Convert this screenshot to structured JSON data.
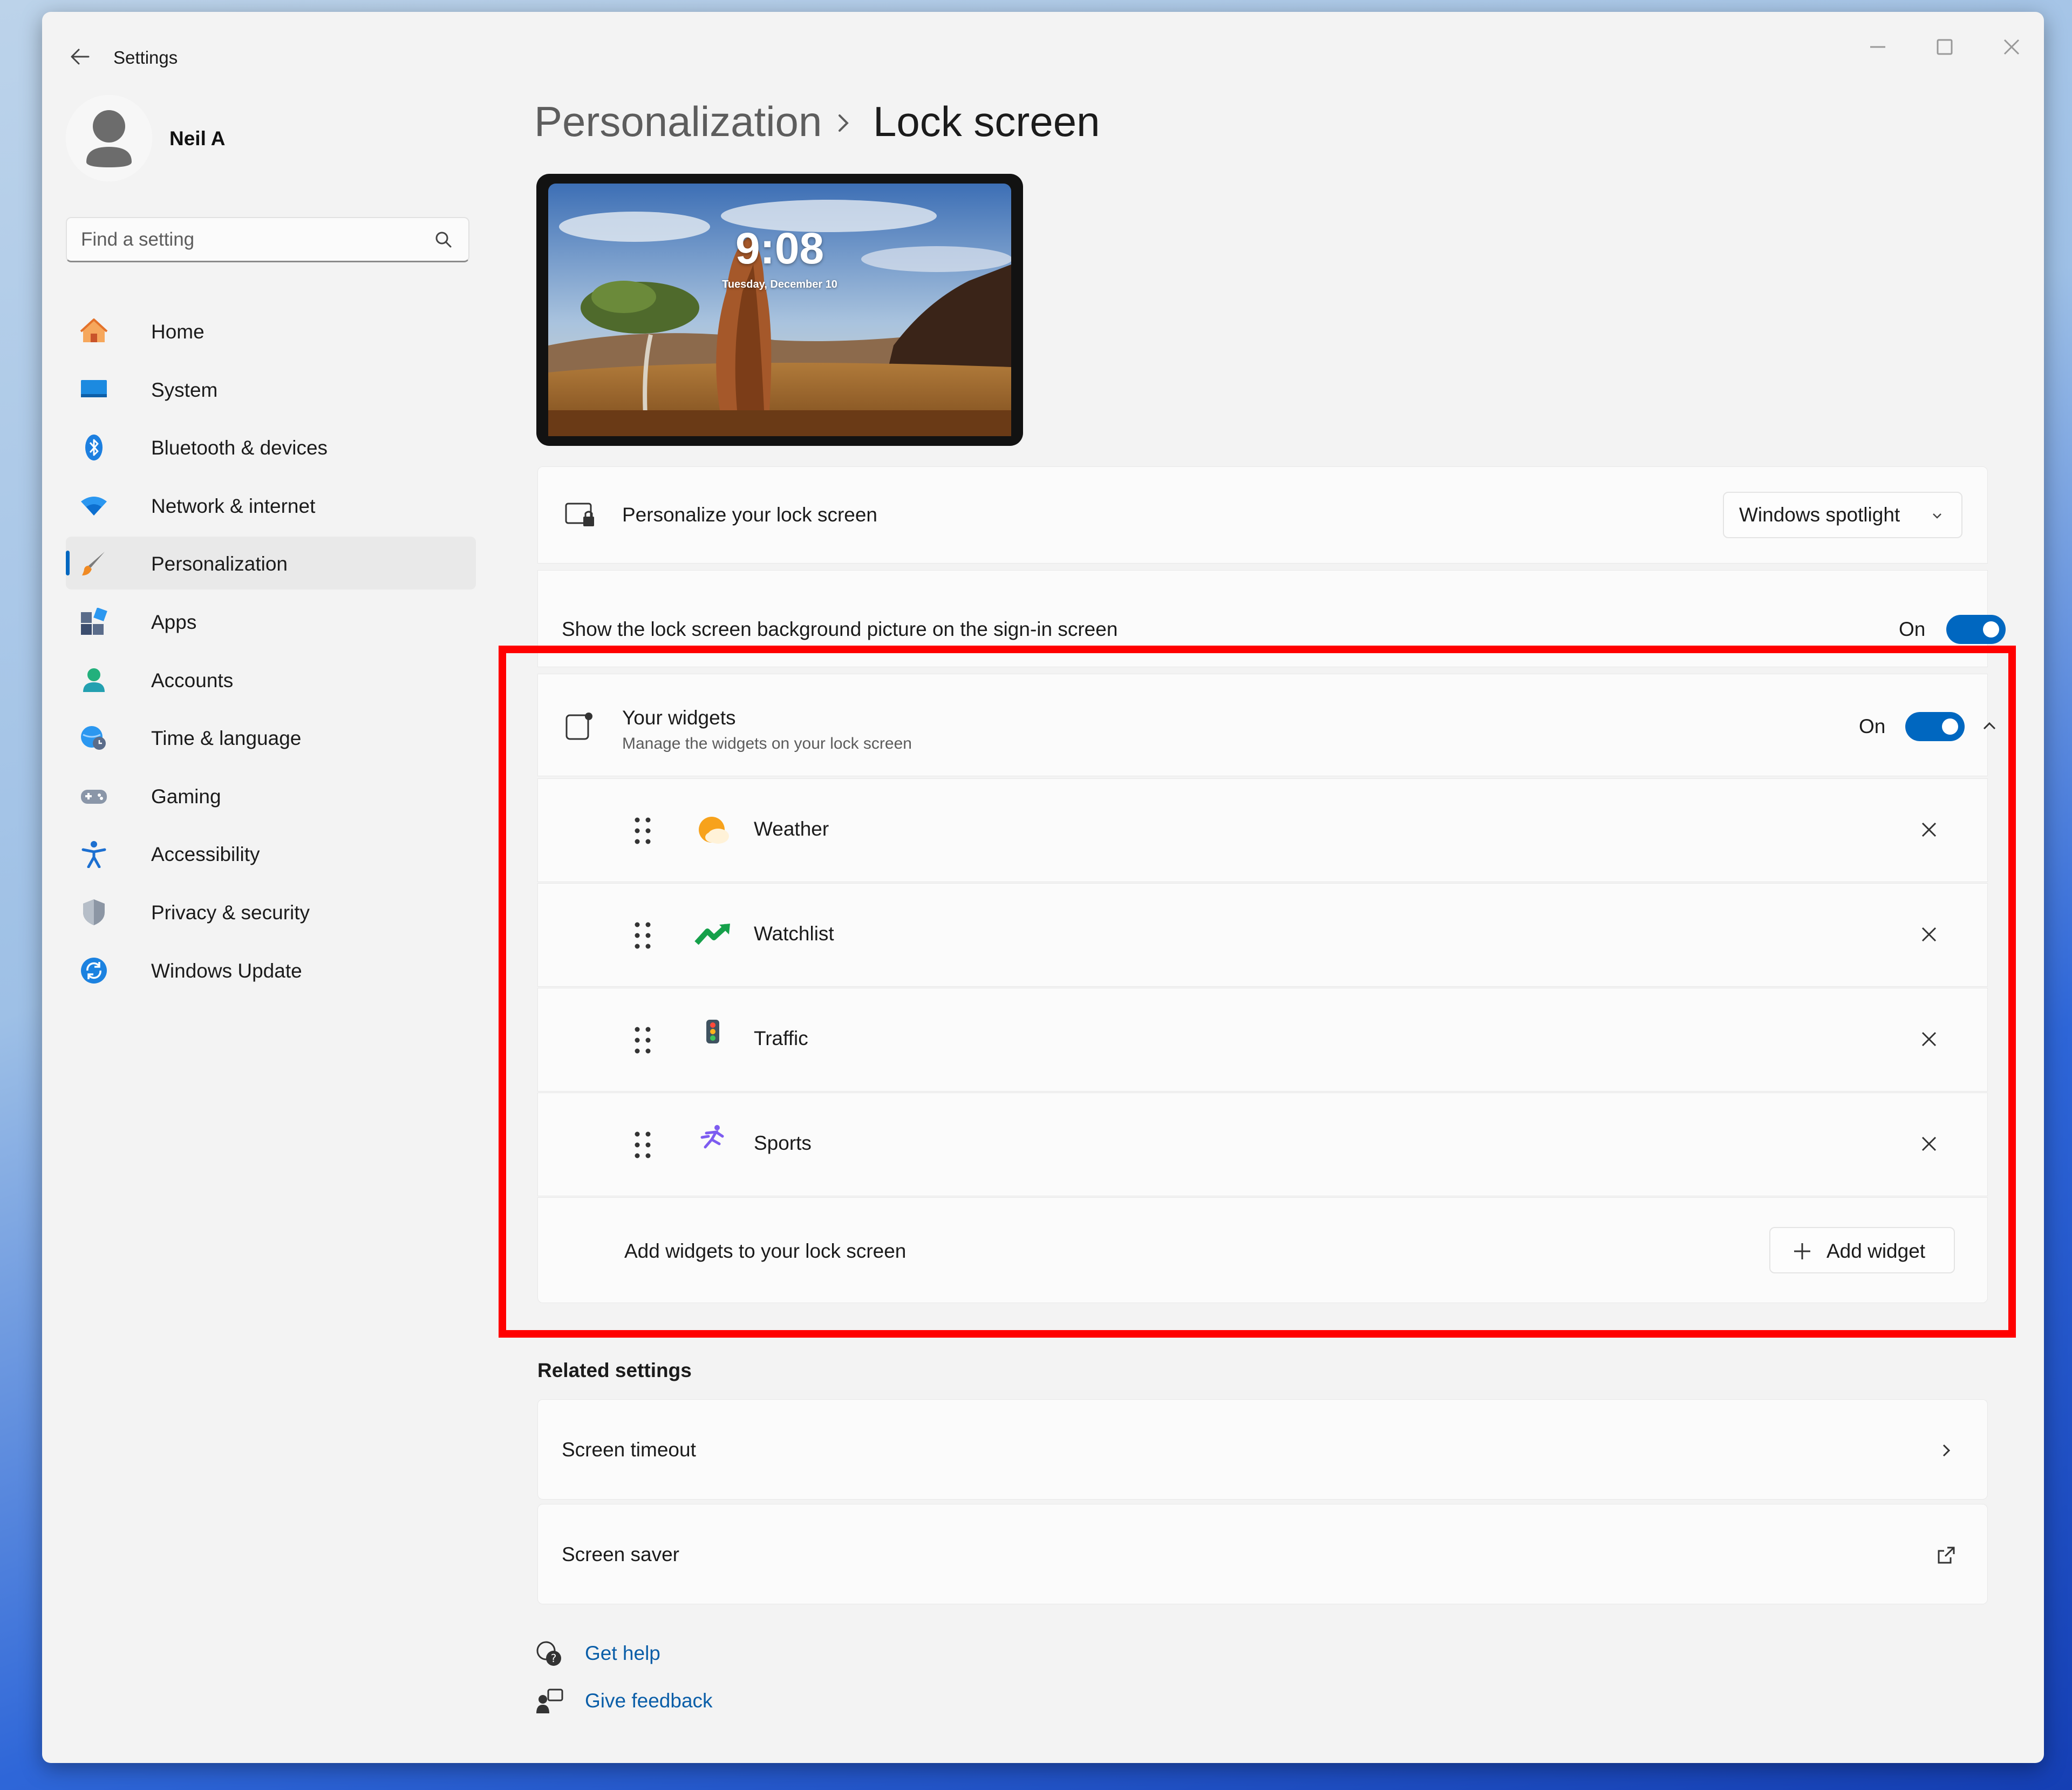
{
  "window": {
    "title": "Settings"
  },
  "profile": {
    "name": "Neil A"
  },
  "search": {
    "placeholder": "Find a setting"
  },
  "sidebar": {
    "items": [
      {
        "label": "Home",
        "icon": "home-icon"
      },
      {
        "label": "System",
        "icon": "system-icon"
      },
      {
        "label": "Bluetooth & devices",
        "icon": "bluetooth-icon"
      },
      {
        "label": "Network & internet",
        "icon": "wifi-icon"
      },
      {
        "label": "Personalization",
        "icon": "brush-icon",
        "active": true
      },
      {
        "label": "Apps",
        "icon": "apps-icon"
      },
      {
        "label": "Accounts",
        "icon": "accounts-icon"
      },
      {
        "label": "Time & language",
        "icon": "globe-clock-icon"
      },
      {
        "label": "Gaming",
        "icon": "gamepad-icon"
      },
      {
        "label": "Accessibility",
        "icon": "accessibility-icon"
      },
      {
        "label": "Privacy & security",
        "icon": "shield-icon"
      },
      {
        "label": "Windows Update",
        "icon": "update-icon"
      }
    ]
  },
  "breadcrumb": {
    "parent": "Personalization",
    "current": "Lock screen"
  },
  "preview": {
    "time": "9:08",
    "date": "Tuesday, December 10"
  },
  "personalize": {
    "label": "Personalize your lock screen",
    "value": "Windows spotlight"
  },
  "signin_bg": {
    "label": "Show the lock screen background picture on the sign-in screen",
    "state": "On"
  },
  "widgets": {
    "title": "Your widgets",
    "subtitle": "Manage the widgets on your lock screen",
    "state": "On",
    "items": [
      {
        "label": "Weather",
        "icon": "weather-icon"
      },
      {
        "label": "Watchlist",
        "icon": "watchlist-icon"
      },
      {
        "label": "Traffic",
        "icon": "traffic-icon"
      },
      {
        "label": "Sports",
        "icon": "sports-icon"
      }
    ],
    "add_label": "Add widgets to your lock screen",
    "add_button": "Add widget"
  },
  "related": {
    "title": "Related settings",
    "items": [
      {
        "label": "Screen timeout",
        "icon": "chevron-right-icon"
      },
      {
        "label": "Screen saver",
        "icon": "external-link-icon"
      }
    ]
  },
  "help": {
    "get_help": "Get help",
    "give_feedback": "Give feedback"
  },
  "colors": {
    "accent": "#0067c0",
    "highlight": "#ff0000",
    "link": "#0a5ea8"
  }
}
